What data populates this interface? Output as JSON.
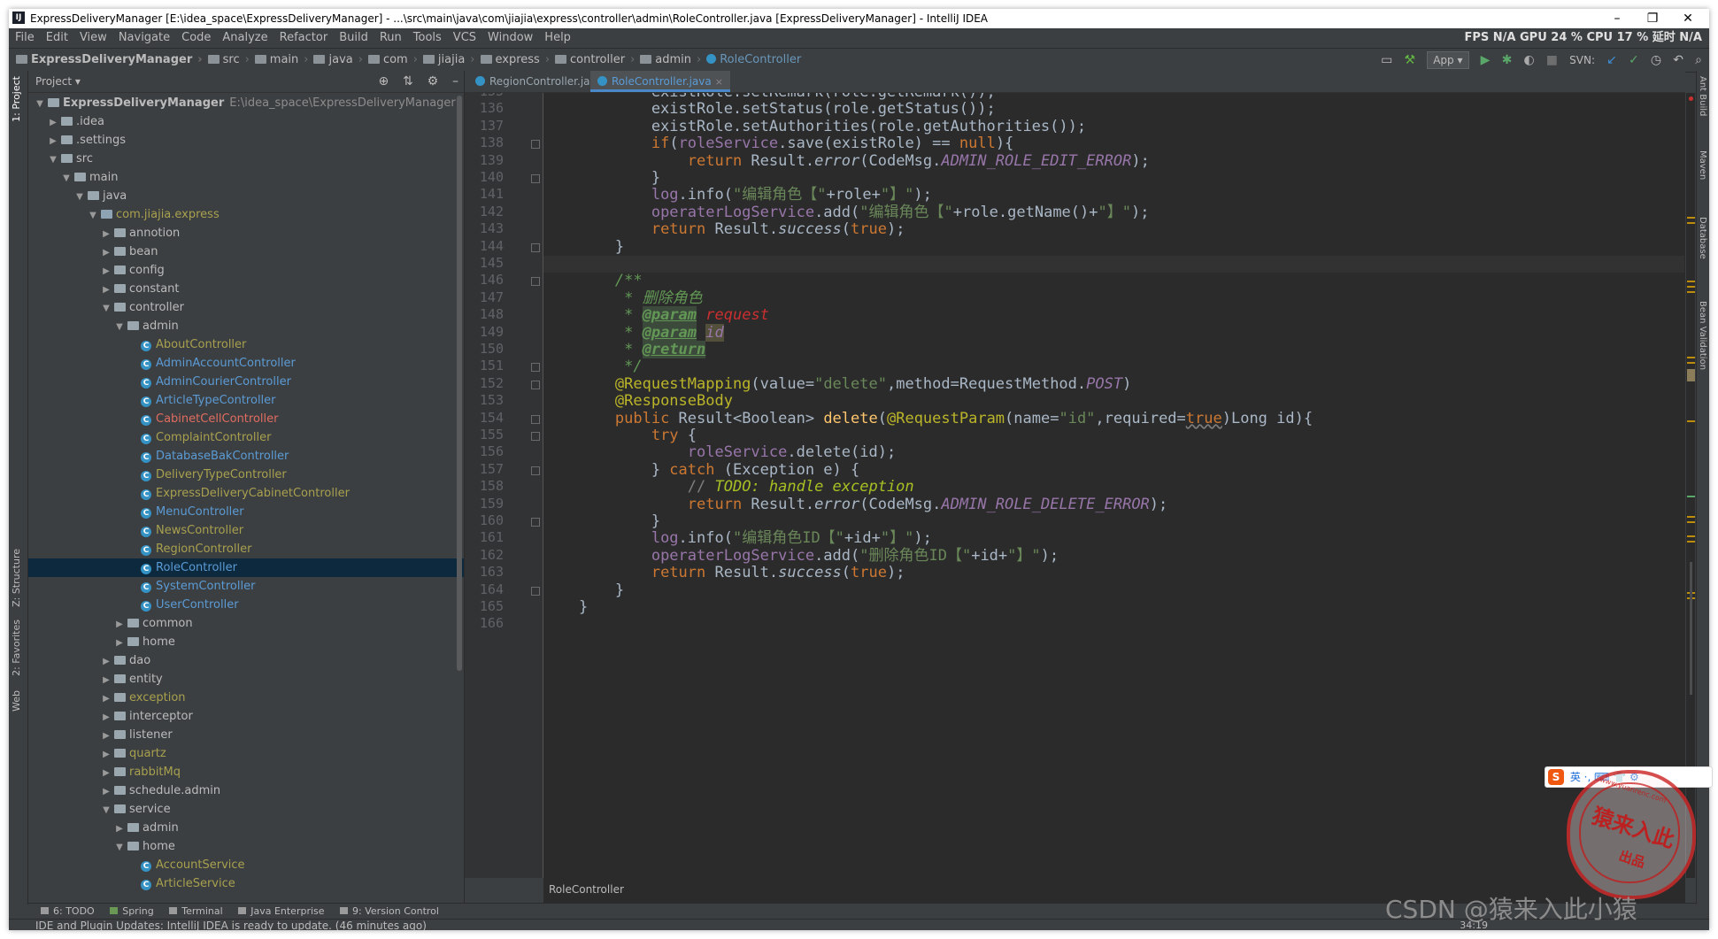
{
  "window": {
    "title": "ExpressDeliveryManager [E:\\idea_space\\ExpressDeliveryManager] - ...\\src\\main\\java\\com\\jiajia\\express\\controller\\admin\\RoleController.java [ExpressDeliveryManager] - IntelliJ IDEA",
    "icon": "IJ",
    "minimize": "–",
    "maximize": "❐",
    "close": "✕"
  },
  "menu": [
    "File",
    "Edit",
    "View",
    "Navigate",
    "Code",
    "Analyze",
    "Refactor",
    "Build",
    "Run",
    "Tools",
    "VCS",
    "Window",
    "Help"
  ],
  "perf_overlay": "FPS  N/A  GPU  24 %  CPU  17 %  延时  N/A",
  "breadcrumbs": [
    "ExpressDeliveryManager",
    "src",
    "main",
    "java",
    "com",
    "jiajia",
    "express",
    "controller",
    "admin",
    "RoleController"
  ],
  "toolbar": {
    "run_config": "App ▾",
    "svn_label": "SVN:",
    "icons": [
      "project-structure-icon",
      "build-icon",
      "run-icon",
      "debug-icon",
      "coverage-icon",
      "stop-icon",
      "svn-update-icon",
      "svn-commit-icon",
      "revert-icon",
      "history-icon",
      "search-icon"
    ]
  },
  "left_stripe": [
    "1: Project",
    "Z: Structure",
    "2: Favorites",
    "Web"
  ],
  "right_stripe": [
    "Ant Build",
    "Maven",
    "Database",
    "Bean Validation"
  ],
  "project_panel": {
    "title": "Project ▾",
    "tree": [
      {
        "depth": 0,
        "arrow": "▼",
        "icon": "folder",
        "label": "ExpressDeliveryManager",
        "style": "bold",
        "path": "E:\\idea_space\\ExpressDeliveryManager"
      },
      {
        "depth": 1,
        "arrow": "▶",
        "icon": "folder",
        "label": ".idea",
        "style": "default"
      },
      {
        "depth": 1,
        "arrow": "▶",
        "icon": "folder",
        "label": ".settings",
        "style": "default"
      },
      {
        "depth": 1,
        "arrow": "▼",
        "icon": "folder",
        "label": "src",
        "style": "default"
      },
      {
        "depth": 2,
        "arrow": "▼",
        "icon": "folder",
        "label": "main",
        "style": "default"
      },
      {
        "depth": 3,
        "arrow": "▼",
        "icon": "folder",
        "label": "java",
        "style": "default"
      },
      {
        "depth": 4,
        "arrow": "▼",
        "icon": "pkg",
        "label": "com.jiajia.express",
        "style": "olive"
      },
      {
        "depth": 5,
        "arrow": "▶",
        "icon": "folder",
        "label": "annotion",
        "style": "default"
      },
      {
        "depth": 5,
        "arrow": "▶",
        "icon": "folder",
        "label": "bean",
        "style": "default"
      },
      {
        "depth": 5,
        "arrow": "▶",
        "icon": "folder",
        "label": "config",
        "style": "default"
      },
      {
        "depth": 5,
        "arrow": "▶",
        "icon": "folder",
        "label": "constant",
        "style": "default"
      },
      {
        "depth": 5,
        "arrow": "▼",
        "icon": "folder",
        "label": "controller",
        "style": "default"
      },
      {
        "depth": 6,
        "arrow": "▼",
        "icon": "folder",
        "label": "admin",
        "style": "default"
      },
      {
        "depth": 7,
        "arrow": "",
        "icon": "class",
        "label": "AboutController",
        "style": "olive"
      },
      {
        "depth": 7,
        "arrow": "",
        "icon": "class",
        "label": "AdminAccountController",
        "style": "blue"
      },
      {
        "depth": 7,
        "arrow": "",
        "icon": "class",
        "label": "AdminCourierController",
        "style": "blue"
      },
      {
        "depth": 7,
        "arrow": "",
        "icon": "class",
        "label": "ArticleTypeController",
        "style": "blue"
      },
      {
        "depth": 7,
        "arrow": "",
        "icon": "class",
        "label": "CabinetCellController",
        "style": "red"
      },
      {
        "depth": 7,
        "arrow": "",
        "icon": "class",
        "label": "ComplaintController",
        "style": "olive"
      },
      {
        "depth": 7,
        "arrow": "",
        "icon": "class",
        "label": "DatabaseBakController",
        "style": "blue"
      },
      {
        "depth": 7,
        "arrow": "",
        "icon": "class",
        "label": "DeliveryTypeController",
        "style": "olive"
      },
      {
        "depth": 7,
        "arrow": "",
        "icon": "class",
        "label": "ExpressDeliveryCabinetController",
        "style": "olive"
      },
      {
        "depth": 7,
        "arrow": "",
        "icon": "class",
        "label": "MenuController",
        "style": "blue"
      },
      {
        "depth": 7,
        "arrow": "",
        "icon": "class",
        "label": "NewsController",
        "style": "olive"
      },
      {
        "depth": 7,
        "arrow": "",
        "icon": "class",
        "label": "RegionController",
        "style": "olive"
      },
      {
        "depth": 7,
        "arrow": "",
        "icon": "class",
        "label": "RoleController",
        "style": "blue",
        "selected": true
      },
      {
        "depth": 7,
        "arrow": "",
        "icon": "class",
        "label": "SystemController",
        "style": "blue"
      },
      {
        "depth": 7,
        "arrow": "",
        "icon": "class",
        "label": "UserController",
        "style": "blue"
      },
      {
        "depth": 6,
        "arrow": "▶",
        "icon": "folder",
        "label": "common",
        "style": "default"
      },
      {
        "depth": 6,
        "arrow": "▶",
        "icon": "folder",
        "label": "home",
        "style": "default"
      },
      {
        "depth": 5,
        "arrow": "▶",
        "icon": "folder",
        "label": "dao",
        "style": "default"
      },
      {
        "depth": 5,
        "arrow": "▶",
        "icon": "folder",
        "label": "entity",
        "style": "default"
      },
      {
        "depth": 5,
        "arrow": "▶",
        "icon": "folder",
        "label": "exception",
        "style": "olive"
      },
      {
        "depth": 5,
        "arrow": "▶",
        "icon": "folder",
        "label": "interceptor",
        "style": "default"
      },
      {
        "depth": 5,
        "arrow": "▶",
        "icon": "folder",
        "label": "listener",
        "style": "default"
      },
      {
        "depth": 5,
        "arrow": "▶",
        "icon": "folder",
        "label": "quartz",
        "style": "olive"
      },
      {
        "depth": 5,
        "arrow": "▶",
        "icon": "folder",
        "label": "rabbitMq",
        "style": "olive"
      },
      {
        "depth": 5,
        "arrow": "▶",
        "icon": "folder",
        "label": "schedule.admin",
        "style": "default"
      },
      {
        "depth": 5,
        "arrow": "▼",
        "icon": "folder",
        "label": "service",
        "style": "default"
      },
      {
        "depth": 6,
        "arrow": "▶",
        "icon": "folder",
        "label": "admin",
        "style": "default"
      },
      {
        "depth": 6,
        "arrow": "▼",
        "icon": "folder",
        "label": "home",
        "style": "default"
      },
      {
        "depth": 7,
        "arrow": "",
        "icon": "class",
        "label": "AccountService",
        "style": "olive"
      },
      {
        "depth": 7,
        "arrow": "",
        "icon": "class",
        "label": "ArticleService",
        "style": "olive"
      }
    ]
  },
  "editor": {
    "tabs": [
      {
        "label": "RegionController.java",
        "active": false
      },
      {
        "label": "RoleController.java",
        "active": true
      }
    ],
    "breadcrumb": "RoleController",
    "lines": [
      {
        "n": "135",
        "fold": false,
        "segs": [
          [
            "            existRole.setRemark(role.getRemark());",
            ""
          ]
        ]
      },
      {
        "n": "136",
        "fold": false,
        "segs": [
          [
            "            existRole.setStatus(role.getStatus());",
            ""
          ]
        ]
      },
      {
        "n": "137",
        "fold": false,
        "segs": [
          [
            "            existRole.setAuthorities(role.getAuthorities());",
            ""
          ]
        ]
      },
      {
        "n": "138",
        "fold": true,
        "segs": [
          [
            "            ",
            ""
          ],
          [
            "if",
            "k"
          ],
          [
            "(",
            ""
          ],
          [
            "roleService",
            "p"
          ],
          [
            ".save(existRole) == ",
            ""
          ],
          [
            "null",
            "k"
          ],
          [
            "){",
            ""
          ]
        ]
      },
      {
        "n": "139",
        "fold": false,
        "segs": [
          [
            "                ",
            ""
          ],
          [
            "return",
            "k"
          ],
          [
            " Result.",
            ""
          ],
          [
            "error",
            "i"
          ],
          [
            "(CodeMsg.",
            ""
          ],
          [
            "ADMIN_ROLE_EDIT_ERROR",
            "pi"
          ],
          [
            ");",
            ""
          ]
        ]
      },
      {
        "n": "140",
        "fold": true,
        "segs": [
          [
            "            }",
            ""
          ]
        ]
      },
      {
        "n": "141",
        "fold": false,
        "segs": [
          [
            "            ",
            ""
          ],
          [
            "log",
            "p"
          ],
          [
            ".info(",
            ""
          ],
          [
            "\"编辑角色【\"",
            "s"
          ],
          [
            "+role+",
            ""
          ],
          [
            "\"】\"",
            "s"
          ],
          [
            ");",
            ""
          ]
        ]
      },
      {
        "n": "142",
        "fold": false,
        "segs": [
          [
            "            ",
            ""
          ],
          [
            "operaterLogService",
            "p"
          ],
          [
            ".add(",
            ""
          ],
          [
            "\"编辑角色【\"",
            "s"
          ],
          [
            "+role.getName()+",
            ""
          ],
          [
            "\"】\"",
            "s"
          ],
          [
            ");",
            ""
          ]
        ]
      },
      {
        "n": "143",
        "fold": false,
        "segs": [
          [
            "            ",
            ""
          ],
          [
            "return",
            "k"
          ],
          [
            " Result.",
            ""
          ],
          [
            "success",
            "i"
          ],
          [
            "(",
            ""
          ],
          [
            "true",
            "k"
          ],
          [
            ");",
            ""
          ]
        ]
      },
      {
        "n": "144",
        "fold": true,
        "segs": [
          [
            "        }",
            ""
          ]
        ]
      },
      {
        "n": "145",
        "fold": false,
        "caret": true,
        "segs": [
          [
            "",
            ""
          ]
        ]
      },
      {
        "n": "146",
        "fold": true,
        "segs": [
          [
            "        ",
            ""
          ],
          [
            "/**",
            "cm"
          ]
        ]
      },
      {
        "n": "147",
        "fold": false,
        "segs": [
          [
            "         ",
            ""
          ],
          [
            "* 删除角色",
            "cm"
          ]
        ]
      },
      {
        "n": "148",
        "fold": false,
        "segs": [
          [
            "         ",
            ""
          ],
          [
            "* ",
            "cm"
          ],
          [
            "@param",
            "tag"
          ],
          [
            " ",
            "cm"
          ],
          [
            "request",
            "red"
          ]
        ]
      },
      {
        "n": "149",
        "fold": false,
        "segs": [
          [
            "         ",
            ""
          ],
          [
            "* ",
            "cm"
          ],
          [
            "@param",
            "tag"
          ],
          [
            " ",
            "cm"
          ],
          [
            "id",
            "hl"
          ]
        ]
      },
      {
        "n": "150",
        "fold": false,
        "segs": [
          [
            "         ",
            ""
          ],
          [
            "* ",
            "cm"
          ],
          [
            "@return",
            "tag"
          ]
        ]
      },
      {
        "n": "151",
        "fold": true,
        "segs": [
          [
            "         ",
            ""
          ],
          [
            "*/",
            "cm"
          ]
        ]
      },
      {
        "n": "152",
        "fold": true,
        "segs": [
          [
            "        ",
            ""
          ],
          [
            "@RequestMapping",
            "a"
          ],
          [
            "(value=",
            ""
          ],
          [
            "\"delete\"",
            "s"
          ],
          [
            ",method=RequestMethod.",
            ""
          ],
          [
            "POST",
            "pi"
          ],
          [
            ")",
            ""
          ]
        ]
      },
      {
        "n": "153",
        "fold": false,
        "segs": [
          [
            "        ",
            ""
          ],
          [
            "@ResponseBody",
            "a"
          ]
        ]
      },
      {
        "n": "154",
        "fold": true,
        "segs": [
          [
            "        ",
            ""
          ],
          [
            "public",
            "k"
          ],
          [
            " Result<Boolean> ",
            ""
          ],
          [
            "delete",
            "f"
          ],
          [
            "(",
            ""
          ],
          [
            "@RequestParam",
            "a"
          ],
          [
            "(name=",
            ""
          ],
          [
            "\"id\"",
            "s"
          ],
          [
            ",required=",
            ""
          ],
          [
            "true",
            "k u"
          ],
          [
            ")Long id){",
            ""
          ]
        ]
      },
      {
        "n": "155",
        "fold": true,
        "segs": [
          [
            "            ",
            ""
          ],
          [
            "try",
            "k"
          ],
          [
            " {",
            ""
          ]
        ]
      },
      {
        "n": "156",
        "fold": false,
        "segs": [
          [
            "                ",
            ""
          ],
          [
            "roleService",
            "p"
          ],
          [
            ".delete(id);",
            ""
          ]
        ]
      },
      {
        "n": "157",
        "fold": true,
        "segs": [
          [
            "            } ",
            ""
          ],
          [
            "catch",
            "k"
          ],
          [
            " (Exception e) {",
            ""
          ]
        ]
      },
      {
        "n": "158",
        "fold": false,
        "segs": [
          [
            "                ",
            ""
          ],
          [
            "// ",
            "cmt"
          ],
          [
            "TODO: handle exception",
            "todo"
          ]
        ]
      },
      {
        "n": "159",
        "fold": false,
        "segs": [
          [
            "                ",
            ""
          ],
          [
            "return",
            "k"
          ],
          [
            " Result.",
            ""
          ],
          [
            "error",
            "i"
          ],
          [
            "(CodeMsg.",
            ""
          ],
          [
            "ADMIN_ROLE_DELETE_ERROR",
            "pi"
          ],
          [
            ");",
            ""
          ]
        ]
      },
      {
        "n": "160",
        "fold": true,
        "segs": [
          [
            "            }",
            ""
          ]
        ]
      },
      {
        "n": "161",
        "fold": false,
        "segs": [
          [
            "            ",
            ""
          ],
          [
            "log",
            "p"
          ],
          [
            ".info(",
            ""
          ],
          [
            "\"编辑角色ID【\"",
            "s"
          ],
          [
            "+id+",
            ""
          ],
          [
            "\"】\"",
            "s"
          ],
          [
            ");",
            ""
          ]
        ]
      },
      {
        "n": "162",
        "fold": false,
        "segs": [
          [
            "            ",
            ""
          ],
          [
            "operaterLogService",
            "p"
          ],
          [
            ".add(",
            ""
          ],
          [
            "\"删除角色ID【\"",
            "s"
          ],
          [
            "+id+",
            ""
          ],
          [
            "\"】\"",
            "s"
          ],
          [
            ");",
            ""
          ]
        ]
      },
      {
        "n": "163",
        "fold": false,
        "segs": [
          [
            "            ",
            ""
          ],
          [
            "return",
            "k"
          ],
          [
            " Result.",
            ""
          ],
          [
            "success",
            "i"
          ],
          [
            "(",
            ""
          ],
          [
            "true",
            "k"
          ],
          [
            ");",
            ""
          ]
        ]
      },
      {
        "n": "164",
        "fold": true,
        "segs": [
          [
            "        }",
            ""
          ]
        ]
      },
      {
        "n": "165",
        "fold": false,
        "segs": [
          [
            "    }",
            ""
          ]
        ]
      },
      {
        "n": "166",
        "fold": false,
        "segs": [
          [
            "",
            ""
          ]
        ]
      }
    ]
  },
  "bottom_tabs": [
    {
      "label": "6: TODO",
      "icon": "todo-icon"
    },
    {
      "label": "Spring",
      "icon": "spring-icon"
    },
    {
      "label": "Terminal",
      "icon": "terminal-icon"
    },
    {
      "label": "Java Enterprise",
      "icon": "java-enterprise-icon"
    },
    {
      "label": "9: Version Control",
      "icon": "version-control-icon"
    }
  ],
  "status": {
    "message": "IDE and Plugin Updates: IntelliJ IDEA is ready to update. (46 minutes ago)",
    "position": "34:19"
  },
  "ime_toolbar": {
    "logo": "S",
    "items": "英 ·, ⌨ 👕 ⚙"
  },
  "seal": {
    "top": "www.yuanrenc.com",
    "main": "猿来入此",
    "bottom": "出品"
  },
  "watermark": "CSDN @猿来入此小猿",
  "colors": {
    "bg": "#2b2b2b",
    "keyword": "#cc7832",
    "string": "#6a8759",
    "field": "#9876aa",
    "annotation": "#bbb529",
    "selection": "#0d293e"
  }
}
